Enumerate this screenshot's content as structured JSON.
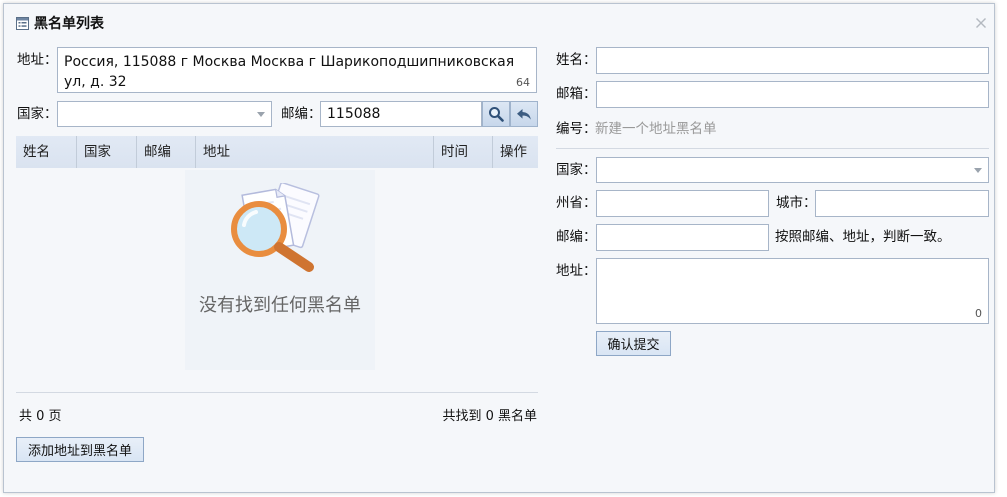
{
  "dialog": {
    "title": "黑名单列表"
  },
  "left": {
    "address_label": "地址：",
    "address_value": "Россия, 115088 г Москва Москва г Шарикоподшипниковская ул, д. 32",
    "address_count": "64",
    "country_label": "国家：",
    "postcode_label": "邮编：",
    "postcode_value": "115088",
    "table": {
      "columns": [
        "姓名",
        "国家",
        "邮编",
        "地址",
        "时间",
        "操作"
      ],
      "rows": []
    },
    "empty_text": "没有找到任何黑名单",
    "pages_text": "共 0 页",
    "found_text": "共找到 0 黑名单",
    "add_button": "添加地址到黑名单"
  },
  "right": {
    "name_label": "姓名：",
    "email_label": "邮箱：",
    "id_label": "编号：",
    "id_value": "新建一个地址黑名单",
    "country_label": "国家：",
    "state_label": "州省：",
    "city_label": "城市：",
    "postcode_label": "邮编：",
    "postcode_hint": "按照邮编、地址，判断一致。",
    "address_label": "地址：",
    "address_count": "0",
    "submit_button": "确认提交"
  },
  "icons": {
    "title": "list-icon",
    "close": "close-icon",
    "search": "search-icon",
    "back": "undo-arrow-icon",
    "dropdown": "chevron-down-icon",
    "empty": "magnifier-documents-icon"
  },
  "colors": {
    "dialog_bg": "#f5f7fa",
    "table_header_bg": "#dae3f0",
    "input_border": "#a7b5c8",
    "button_bg": "#d9e5f4",
    "muted_text": "#999999",
    "empty_text": "#666666"
  }
}
